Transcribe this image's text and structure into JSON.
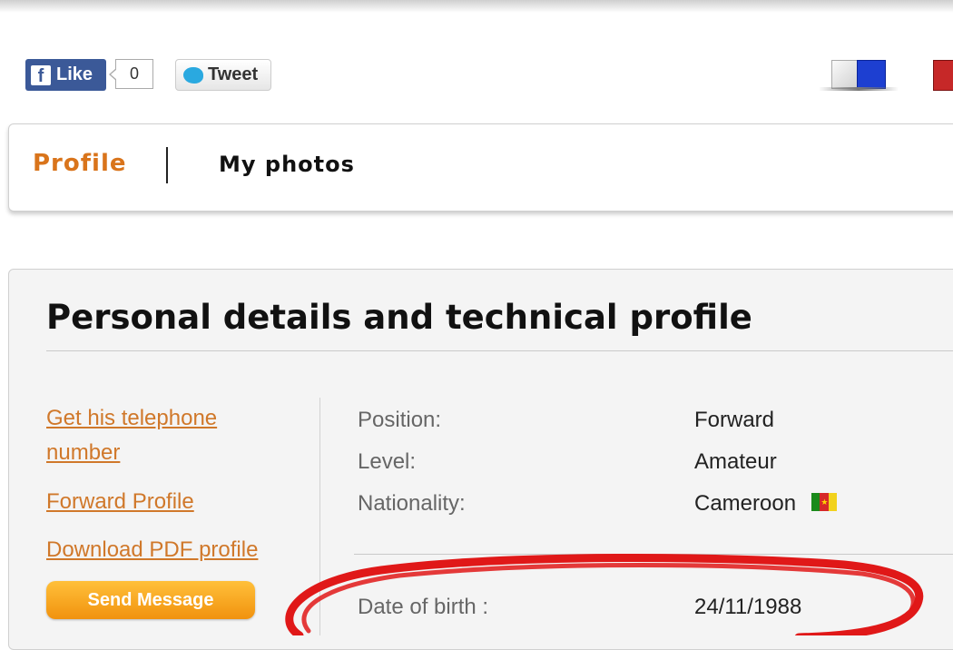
{
  "social": {
    "like_label": "Like",
    "like_count": "0",
    "tweet_label": "Tweet"
  },
  "nav": {
    "tabs": [
      {
        "label": "Profile",
        "active": true
      },
      {
        "label": "My photos",
        "active": false
      }
    ]
  },
  "profile": {
    "section_title": "Personal details and technical profile",
    "links": {
      "telephone": "Get his telephone number",
      "forward": "Forward Profile",
      "pdf": "Download PDF profile"
    },
    "send_button": "Send Message",
    "details": [
      {
        "label": "Position:",
        "value": "Forward"
      },
      {
        "label": "Level:",
        "value": "Amateur"
      },
      {
        "label": "Nationality:",
        "value": "Cameroon"
      }
    ],
    "birth": {
      "label": "Date of birth :",
      "value": "24/11/1988"
    }
  },
  "colors": {
    "accent": "#d9741b",
    "link": "#d0782a",
    "button": "#f5a623",
    "annotation": "#e01818"
  }
}
